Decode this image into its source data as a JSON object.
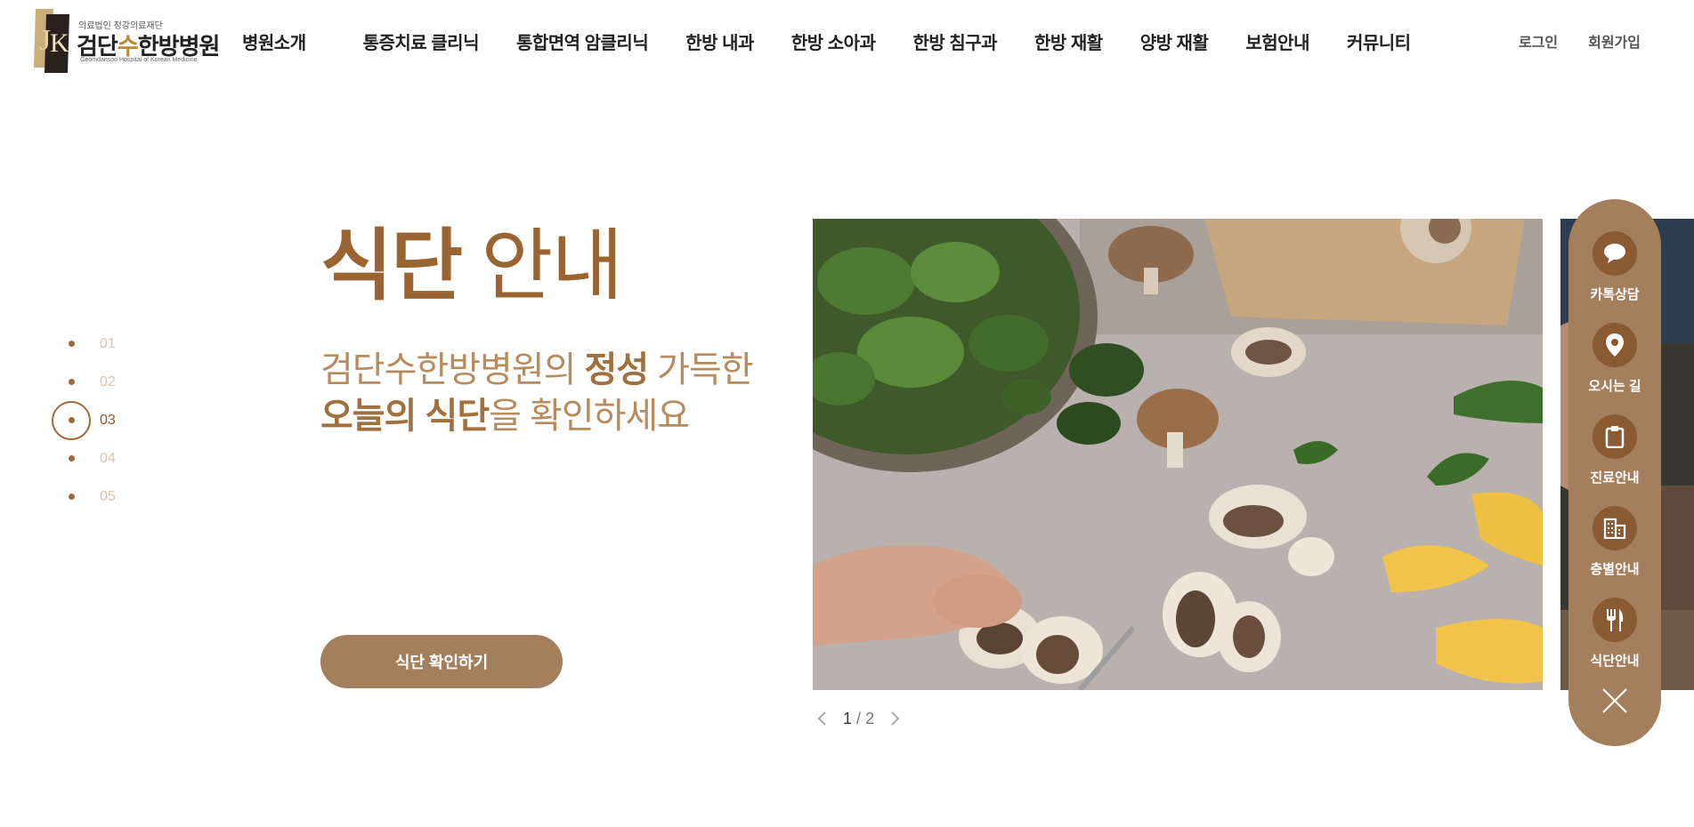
{
  "logo": {
    "small": "의료법인 정강의료재단",
    "main_prefix": "검단",
    "main_accent": "수",
    "main_suffix": "한방병원",
    "en": "Geomdansoo Hospital of Korean Medicine"
  },
  "nav": [
    "병원소개",
    "통증치료 클리닉",
    "통합면역 암클리닉",
    "한방 내과",
    "한방 소아과",
    "한방 침구과",
    "한방 재활",
    "양방 재활",
    "보험안내",
    "커뮤니티"
  ],
  "util": {
    "login": "로그인",
    "join": "회원가입"
  },
  "pager": {
    "items": [
      "01",
      "02",
      "03",
      "04",
      "05"
    ],
    "active_index": 2
  },
  "hero": {
    "title_strong": "식단",
    "title_light": " 안내",
    "subtitle_line1_a": "검단수한방병원의 ",
    "subtitle_line1_b": "정성",
    "subtitle_line1_c": " 가득한",
    "subtitle_line2_a": "오늘의 식단",
    "subtitle_line2_b": "을 확인하세요",
    "cta_label": "식단 확인하기"
  },
  "slider": {
    "current": "1",
    "separator": "/",
    "total": "2"
  },
  "quick_menu": {
    "items": [
      {
        "label": "카톡상담",
        "icon": "chat-bubble-icon"
      },
      {
        "label": "오시는 길",
        "icon": "map-pin-icon"
      },
      {
        "label": "진료안내",
        "icon": "clipboard-icon"
      },
      {
        "label": "층별안내",
        "icon": "building-icon"
      },
      {
        "label": "식단안내",
        "icon": "fork-knife-icon"
      }
    ]
  },
  "colors": {
    "brand_brown": "#a47f5e",
    "title_brown": "#9a6432",
    "icon_bg": "#8a5a32",
    "pager_inactive": "#dcc2a8"
  }
}
